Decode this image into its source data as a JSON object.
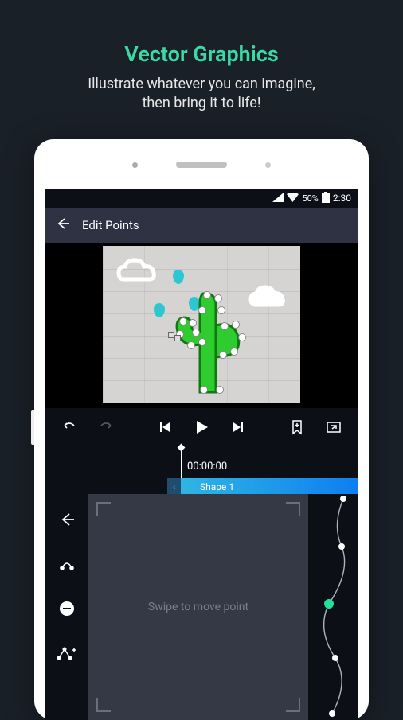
{
  "hero": {
    "title": "Vector Graphics",
    "subtitle_line1": "Illustrate whatever you can imagine,",
    "subtitle_line2": "then bring it to life!"
  },
  "status_bar": {
    "battery_pct": "50%",
    "time": "2:30"
  },
  "header": {
    "title": "Edit Points"
  },
  "timeline": {
    "time": "00:00:00",
    "track_label": "Shape 1"
  },
  "editor": {
    "swipe_hint": "Swipe to move point"
  }
}
